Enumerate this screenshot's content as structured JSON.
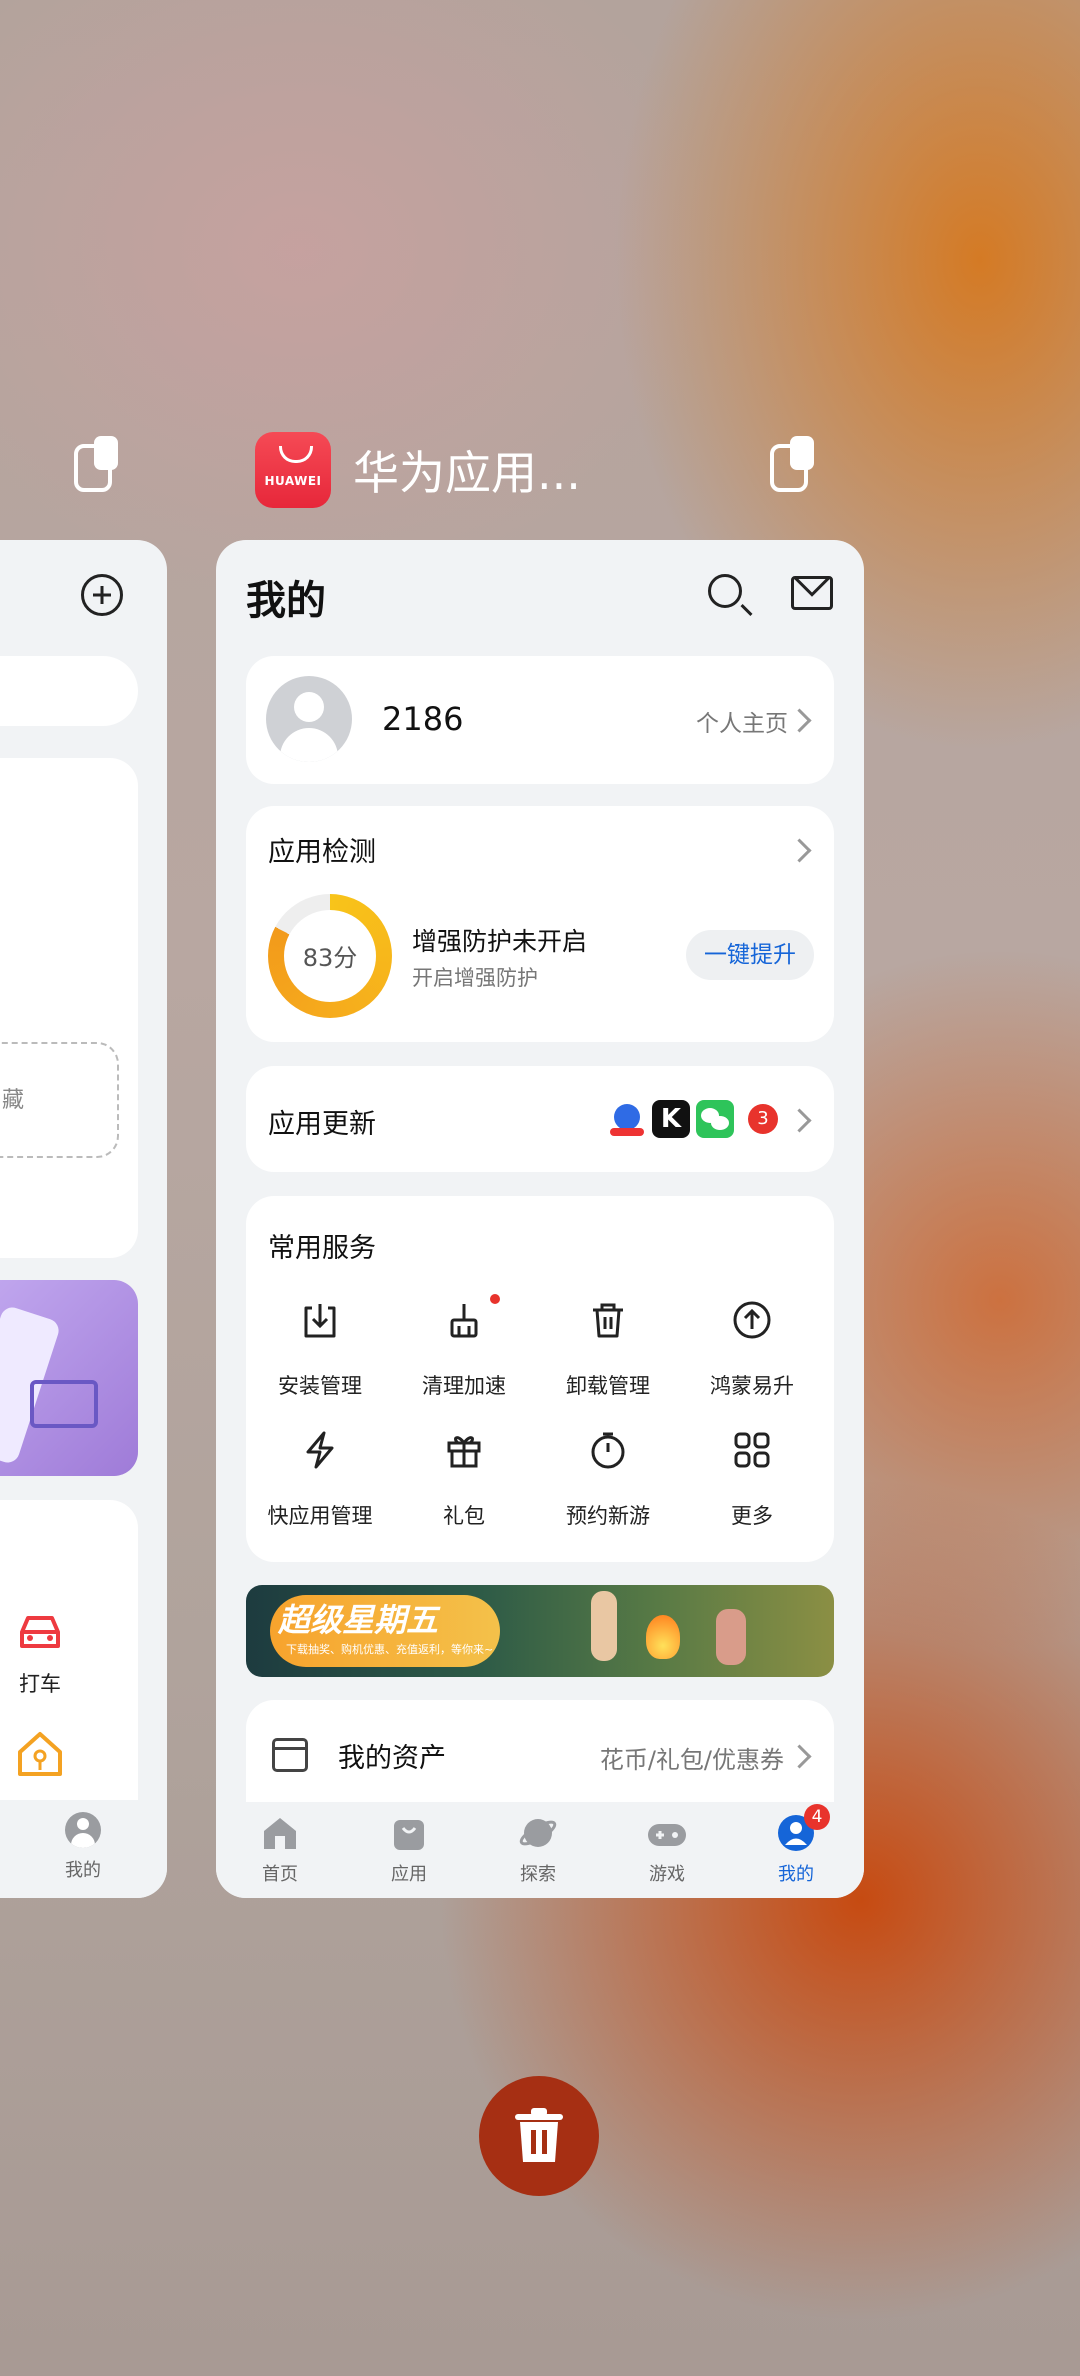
{
  "left_card": {
    "dashed_text": "藏",
    "taxi_label": "打车",
    "nav_label": "我的"
  },
  "app_header": {
    "logo_text": "HUAWEI",
    "title": "华为应用..."
  },
  "page": {
    "title": "我的"
  },
  "profile": {
    "username": "2186",
    "home_link": "个人主页"
  },
  "app_check": {
    "title": "应用检测",
    "score": "83分",
    "score_value": 83,
    "status": "增强防护未开启",
    "hint": "开启增强防护",
    "button": "一键提升"
  },
  "app_update": {
    "title": "应用更新",
    "count": "3"
  },
  "services": {
    "title": "常用服务",
    "items": [
      {
        "label": "安装管理",
        "icon": "download-box-icon"
      },
      {
        "label": "清理加速",
        "icon": "broom-icon"
      },
      {
        "label": "卸载管理",
        "icon": "trash-icon"
      },
      {
        "label": "鸿蒙易升",
        "icon": "arrow-up-circle-icon"
      },
      {
        "label": "快应用管理",
        "icon": "lightning-icon"
      },
      {
        "label": "礼包",
        "icon": "gift-icon"
      },
      {
        "label": "预约新游",
        "icon": "stopwatch-icon"
      },
      {
        "label": "更多",
        "icon": "grid-icon"
      }
    ]
  },
  "banner": {
    "title": "超级星期五",
    "subtitle": "下载抽奖、购机优惠、充值返利，等你来~"
  },
  "assets": {
    "title": "我的资产",
    "detail": "花币/礼包/优惠券"
  },
  "bottom_nav": {
    "items": [
      "首页",
      "应用",
      "探索",
      "游戏",
      "我的"
    ],
    "badge": "4"
  },
  "colors": {
    "accent": "#1565d8",
    "badge": "#e8332c",
    "logo": "#ec3040",
    "score_ring": "#f6ab1c",
    "clear_all": "#a62f13"
  }
}
